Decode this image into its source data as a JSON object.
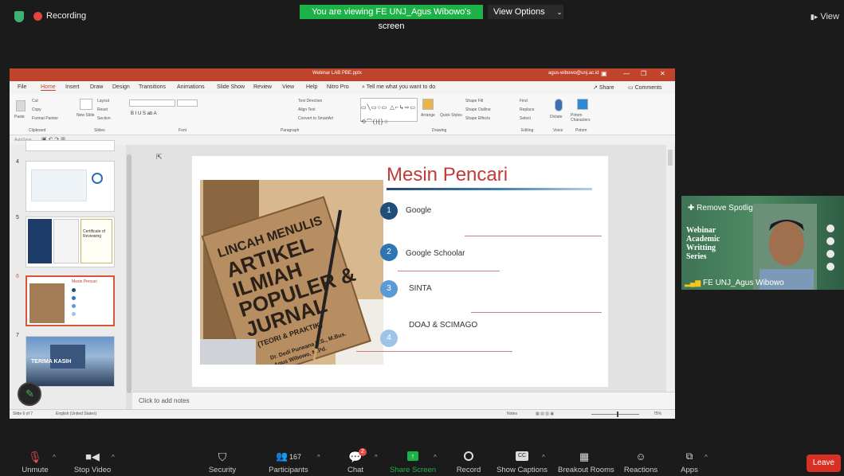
{
  "top": {
    "recording_label": "Recording",
    "viewing_banner": "You are viewing FE UNJ_Agus Wibowo's screen",
    "view_options": "View Options",
    "view_right": "View"
  },
  "ppt": {
    "filename": "Webinar LAB PBE.pptx",
    "user": "agus-wibowo@unj.ac.id",
    "menu": [
      "File",
      "Home",
      "Insert",
      "Draw",
      "Design",
      "Transitions",
      "Animations",
      "Slide Show",
      "Review",
      "View",
      "Help",
      "Nitro Pro"
    ],
    "tell_me": "Tell me what you want to do",
    "share": "Share",
    "comments": "Comments",
    "ribbon_groups": [
      "Clipboard",
      "Slides",
      "Font",
      "Paragraph",
      "Drawing",
      "Editing",
      "Voice",
      "Potom"
    ],
    "ribbon_labels": {
      "paste": "Paste",
      "cut": "Cut",
      "copy": "Copy",
      "format_painter": "Format Painter",
      "new_slide": "New Slide",
      "layout": "Layout",
      "reset": "Reset",
      "section": "Section",
      "text_direction": "Text Direction",
      "align_text": "Align Text",
      "convert_smartart": "Convert to SmartArt",
      "arrange": "Arrange",
      "quick_styles": "Quick Styles",
      "shape_fill": "Shape Fill",
      "shape_outline": "Shape Outline",
      "shape_effects": "Shape Effects",
      "find": "Find",
      "replace": "Replace",
      "select": "Select",
      "dictate": "Dictate",
      "potom_characters": "Potom Characters"
    },
    "autosave": "AutoSave",
    "slide_numbers": [
      "4",
      "5",
      "6",
      "7"
    ],
    "thumb_certificate": "Certificate of Reviewing",
    "thumb_mesin": "Mesin Pencari",
    "thumb_terima": "TERIMA KASIH",
    "notes_placeholder": "Click to add notes",
    "status_slide": "Slide 6 of 7",
    "status_lang": "English (United States)",
    "status_notes": "Notes",
    "zoom": "75%"
  },
  "slide": {
    "title": "Mesin Pencari",
    "items": [
      {
        "num": "1",
        "text": "Google"
      },
      {
        "num": "2",
        "text": "Google Schoolar"
      },
      {
        "num": "3",
        "text": "SINTA"
      },
      {
        "num": "4",
        "text": "DOAJ & SCIMAGO"
      }
    ],
    "book": {
      "line1": "LINCAH MENULIS",
      "line2": "ARTIKEL",
      "line3": "ILMIAH",
      "line4": "POPULER &",
      "line5": "JURNAL",
      "line6": "(TEORI & PRAKTIK)",
      "author1": "Dr. Dedi Purwana E.S., M.Bus.",
      "author2": "Agus Wibowo, M.Pd."
    },
    "colors": {
      "dark": "#1f4e79",
      "mid": "#2e75b6",
      "light": "#9dc3e6",
      "title": "#c23a3a"
    }
  },
  "video": {
    "remove_spotlight": "Remove Spotlight",
    "webinar": "Webinar",
    "academic": "Academic",
    "writting": "Writting",
    "series": "Series",
    "participant_name": "FE UNJ_Agus Wibowo"
  },
  "toolbar": {
    "unmute": "Unmute",
    "stop_video": "Stop Video",
    "security": "Security",
    "participants": "Participants",
    "participants_count": "167",
    "chat": "Chat",
    "chat_badge": "2",
    "share_screen": "Share Screen",
    "record": "Record",
    "show_captions": "Show Captions",
    "cc": "CC",
    "breakout_rooms": "Breakout Rooms",
    "reactions": "Reactions",
    "apps": "Apps",
    "leave": "Leave"
  }
}
